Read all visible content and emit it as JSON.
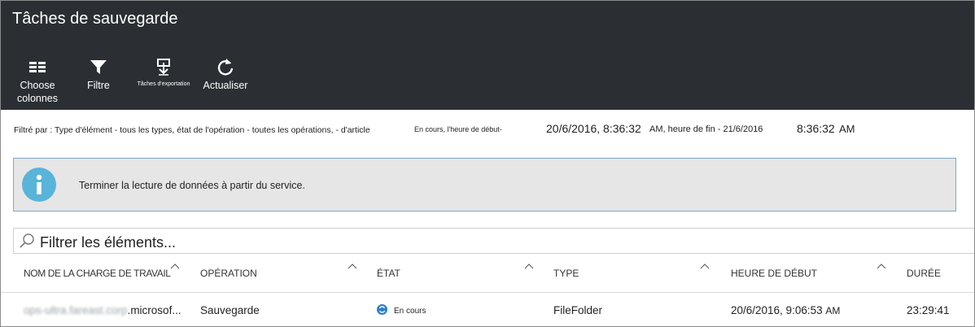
{
  "header": {
    "title": "Tâches de sauvegarde",
    "toolbar": [
      {
        "icon": "columns-icon",
        "label": "Choose colonnes",
        "label_line1": "Choose",
        "label_line2": "colonnes"
      },
      {
        "icon": "filter-icon",
        "label": "Filtre"
      },
      {
        "icon": "export-icon",
        "label": "Tâches d'exportation"
      },
      {
        "icon": "refresh-icon",
        "label": "Actualiser"
      }
    ]
  },
  "filter_summary": {
    "prefix": "Filtré par : Type d'élément - tous les types, état de l'opération - toutes les opérations, - d'article",
    "status_part": "En cours, l'heure de début-",
    "start_date": "20/6/2016, 8:36:32",
    "mid_text": "AM, heure de fin - 21/6/2016",
    "end_time": "8:36:32",
    "end_ampm": "AM"
  },
  "banner": {
    "icon": "info-icon",
    "message": "Terminer la lecture de données à partir du service."
  },
  "search": {
    "placeholder": "Filtrer les éléments..."
  },
  "table": {
    "columns": [
      "NOM DE LA CHARGE DE TRAVAIL",
      "OPÉRATION",
      "ÉTAT",
      "TYPE",
      "HEURE DE DÉBUT",
      "DURÉE"
    ],
    "rows": [
      {
        "workload_blurred": "ops-ultra.fareast.corp",
        "workload_visible": ".microsof...",
        "operation": "Sauvegarde",
        "status_icon": "in-progress-icon",
        "status": "En cours",
        "type": "FileFolder",
        "start_time": "20/6/2016, 9:06:53",
        "start_ampm": "AM",
        "duration": "23:29:41"
      }
    ]
  },
  "colors": {
    "header_bg": "#2b2f33",
    "banner_bg": "#e6e6e6",
    "info_icon": "#59b4d9",
    "status_icon": "#2f7fcb"
  }
}
